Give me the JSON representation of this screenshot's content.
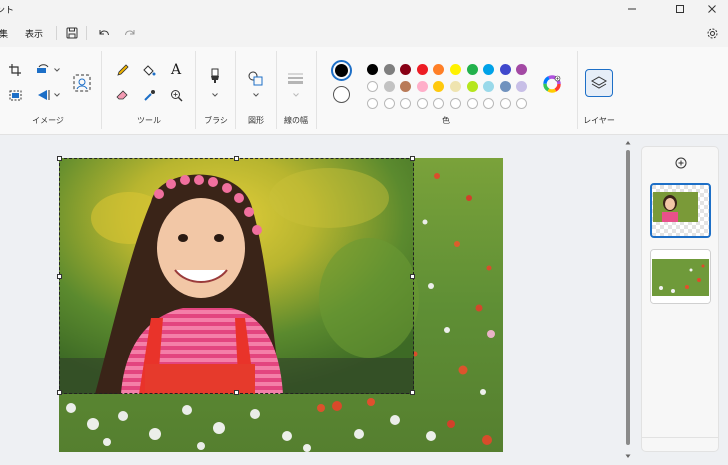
{
  "app": {
    "title_fragment": "ント"
  },
  "menu": {
    "edit_fragment": "集",
    "view": "表示",
    "icons": {
      "save": "save-icon",
      "undo": "undo-icon",
      "redo": "redo-icon",
      "settings": "gear-icon"
    }
  },
  "ribbon": {
    "groups": {
      "image": "イメージ",
      "tools": "ツール",
      "brushes": "ブラシ",
      "shapes": "図形",
      "size": "線の幅",
      "colors": "色",
      "layers": "レイヤー"
    },
    "text_tool_glyph": "A"
  },
  "colors": {
    "primary": "#000000",
    "secondary": "#ffffff",
    "row1": [
      "#000000",
      "#7f7f7f",
      "#880015",
      "#ed1c24",
      "#ff7f27",
      "#fff200",
      "#22b14c",
      "#00a2e8",
      "#3f48cc",
      "#a349a4"
    ],
    "row2": [
      "#ffffff",
      "#c3c3c3",
      "#b97a57",
      "#ffaec9",
      "#ffc90e",
      "#efe4b0",
      "#b5e61d",
      "#99d9ea",
      "#7092be",
      "#c8bfe7"
    ],
    "row3_count": "10",
    "accent": "#1d6fc7"
  },
  "layers": {
    "add_icon": "plus-circle-icon"
  }
}
